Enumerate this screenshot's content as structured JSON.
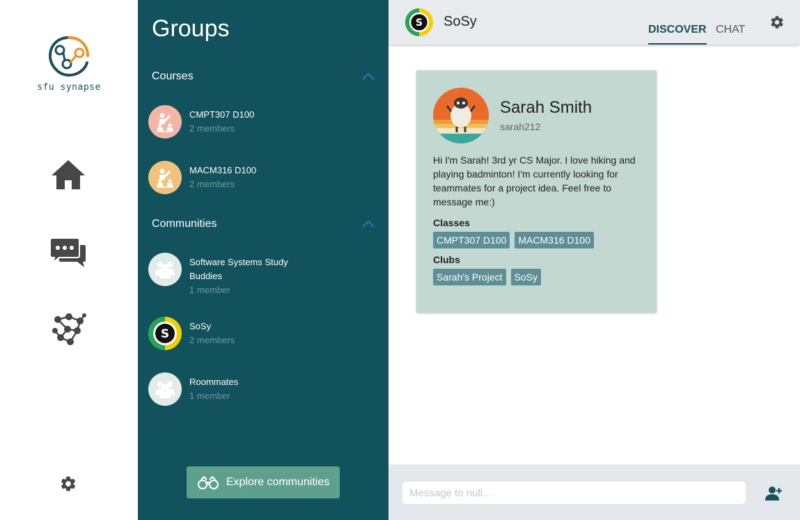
{
  "brand": {
    "name": "sfu synapse"
  },
  "rail": {
    "items": [
      {
        "icon": "home-icon"
      },
      {
        "icon": "chat-icon"
      },
      {
        "icon": "network-icon"
      }
    ],
    "settings_icon": "gear-icon"
  },
  "groups": {
    "title": "Groups",
    "courses": {
      "label": "Courses",
      "items": [
        {
          "name": "CMPT307 D100",
          "meta": "2 members",
          "color": "#f4b5a6"
        },
        {
          "name": "MACM316 D100",
          "meta": "2 members",
          "color": "#f0c27e"
        }
      ]
    },
    "communities": {
      "label": "Communities",
      "items": [
        {
          "name": "Software Systems Study Buddies",
          "meta": "1 member"
        },
        {
          "name": "SoSy",
          "meta": "2 members"
        },
        {
          "name": "Roommates",
          "meta": "1 member"
        }
      ]
    },
    "explore_label": "Explore communities"
  },
  "main": {
    "group_name": "SoSy",
    "group_logo_letter": "S",
    "tabs": {
      "discover": "DISCOVER",
      "chat": "CHAT"
    },
    "profile": {
      "name": "Sarah Smith",
      "username": "sarah212",
      "bio": "Hi I'm Sarah! 3rd yr CS Major. I love hiking and playing badminton! I'm currently looking for teammates for a project idea. Feel free to message me:)",
      "classes_label": "Classes",
      "classes": [
        "CMPT307 D100",
        "MACM316 D100"
      ],
      "clubs_label": "Clubs",
      "clubs": [
        "Sarah's Project",
        "SoSy"
      ]
    },
    "message_placeholder": "Message to null..."
  },
  "colors": {
    "panel": "#11525c",
    "accent": "#15525e",
    "card": "#c2d8d1",
    "chip": "#5e8f96",
    "explore_button": "#5fa08c"
  }
}
